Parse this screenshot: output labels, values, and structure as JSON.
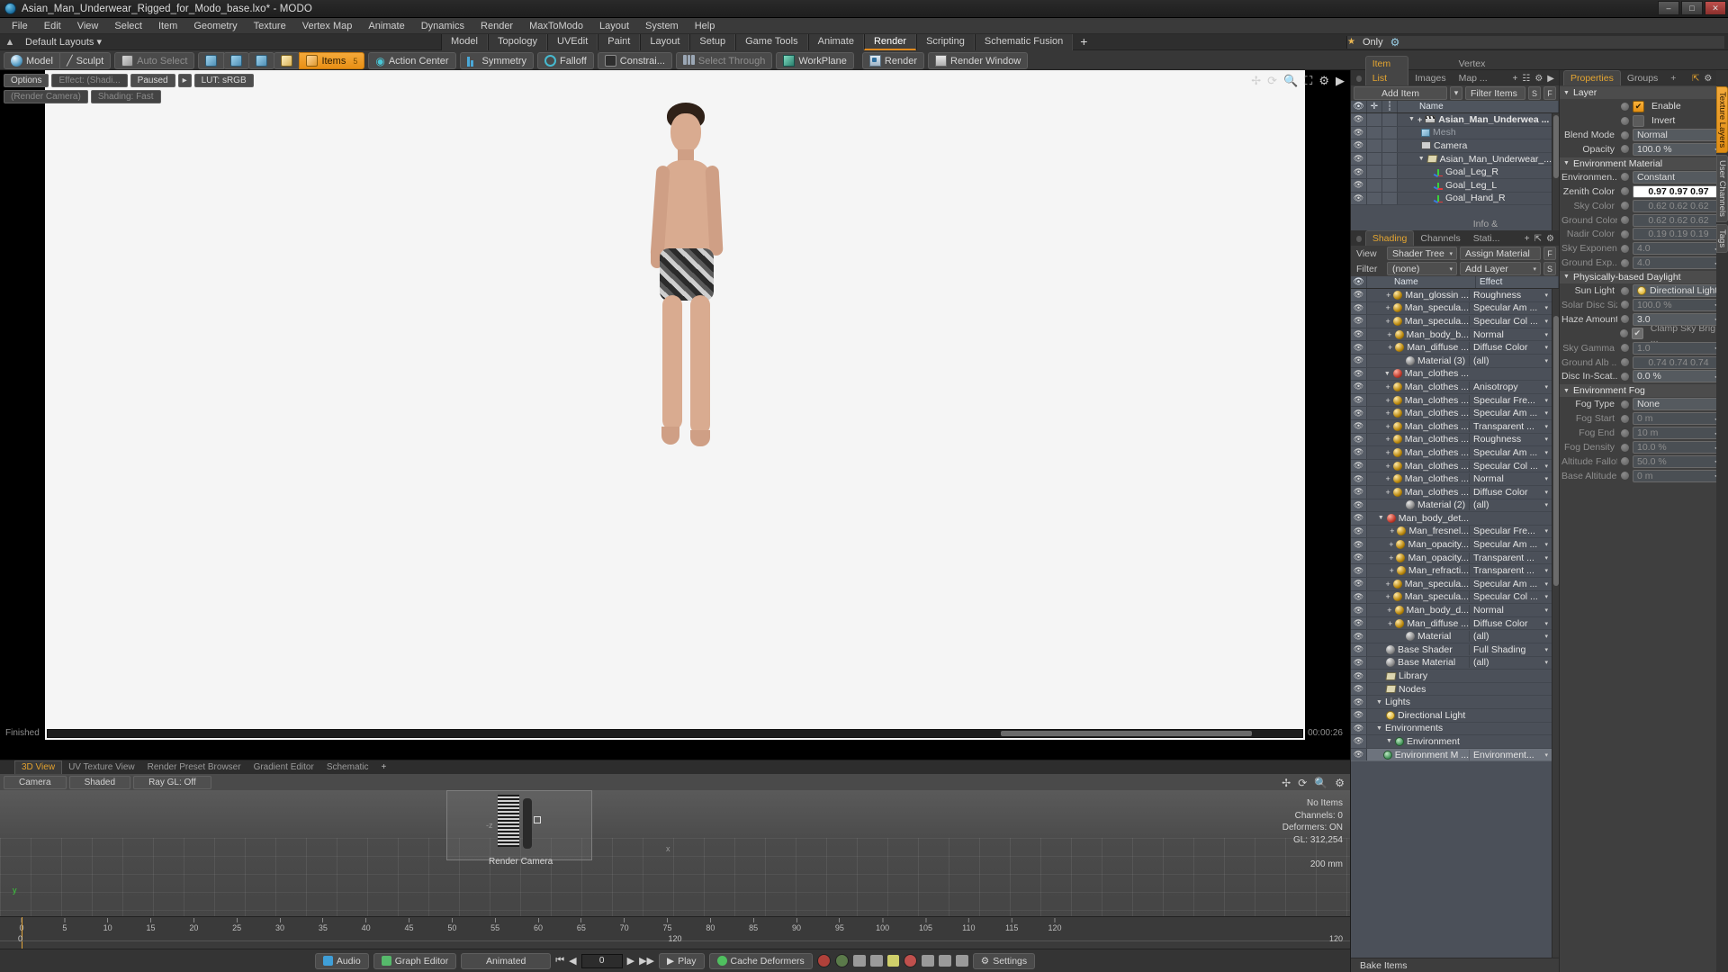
{
  "window": {
    "title": "Asian_Man_Underwear_Rigged_for_Modo_base.lxo* - MODO",
    "app_icon": "modo-app-icon",
    "minimize": "–",
    "maximize": "□",
    "close": "✕"
  },
  "menu": [
    "File",
    "Edit",
    "View",
    "Select",
    "Item",
    "Geometry",
    "Texture",
    "Vertex Map",
    "Animate",
    "Dynamics",
    "Render",
    "MaxToModo",
    "Layout",
    "System",
    "Help"
  ],
  "layout_row": {
    "home_icon": "home-icon",
    "preset_label": "Default Layouts",
    "tabs": [
      {
        "label": "Model",
        "active": false
      },
      {
        "label": "Topology",
        "active": false
      },
      {
        "label": "UVEdit",
        "active": false
      },
      {
        "label": "Paint",
        "active": false
      },
      {
        "label": "Layout",
        "active": false
      },
      {
        "label": "Setup",
        "active": false
      },
      {
        "label": "Game Tools",
        "active": false
      },
      {
        "label": "Animate",
        "active": false
      },
      {
        "label": "Render",
        "active": true
      },
      {
        "label": "Scripting",
        "active": false
      },
      {
        "label": "Schematic Fusion",
        "active": false
      }
    ],
    "add_tab": "+",
    "only_label": "Only",
    "star_icon": "star-icon",
    "gear_icon": "gear-icon"
  },
  "toolbar": {
    "mode_group": [
      {
        "label": "Model",
        "icon": "sphere-icon",
        "active": false
      },
      {
        "label": "Sculpt",
        "icon": "brush-icon",
        "active": false
      }
    ],
    "select_group": [
      {
        "label": "Auto Select",
        "icon": "cube-gray-icon",
        "dim": true
      }
    ],
    "component_group": [
      {
        "label": "",
        "icon": "vertex-cube-icon",
        "active": false
      },
      {
        "label": "",
        "icon": "edge-cube-icon",
        "active": false
      },
      {
        "label": "",
        "icon": "polygon-cube-icon",
        "active": false
      },
      {
        "label": "",
        "icon": "material-cube-icon",
        "active": false
      },
      {
        "label": "Items",
        "icon": "items-cube-icon",
        "active": true,
        "key": "5"
      }
    ],
    "tools_group": [
      {
        "label": "Action Center",
        "icon": "action-center-icon"
      },
      {
        "label": "Symmetry",
        "icon": "symmetry-icon"
      },
      {
        "label": "Falloff",
        "icon": "falloff-icon"
      },
      {
        "label": "Constrai...",
        "icon": "constraint-icon"
      },
      {
        "label": "Select Through",
        "icon": "select-through-icon",
        "dim": true
      },
      {
        "label": "WorkPlane",
        "icon": "workplane-icon"
      }
    ],
    "render_group": [
      {
        "label": "Render",
        "icon": "render-icon"
      },
      {
        "label": "Render Window",
        "icon": "render-window-icon"
      }
    ]
  },
  "viewport": {
    "chips": [
      {
        "label": "Options",
        "dim": false
      },
      {
        "label": "Effect: (Shadi...",
        "dim": true
      },
      {
        "label": "Paused",
        "dim": false
      },
      {
        "label": "▸",
        "dim": false
      },
      {
        "label": "LUT: sRGB",
        "dim": false
      }
    ],
    "camera_chip": "(Render Camera)",
    "shading_chip": "Shading: Fast",
    "icons": [
      "pan-icon",
      "rotate-icon",
      "zoom-icon",
      "fit-icon",
      "gear-icon",
      "chevron-right-icon"
    ],
    "status": "Finished",
    "time": "00:00:26"
  },
  "bottom_panel": {
    "tabs": [
      {
        "label": "3D View",
        "active": true
      },
      {
        "label": "UV Texture View",
        "active": false
      },
      {
        "label": "Render Preset Browser",
        "active": false
      },
      {
        "label": "Gradient Editor",
        "active": false
      },
      {
        "label": "Schematic",
        "active": false
      },
      {
        "label": "+",
        "active": false
      }
    ],
    "chips": [
      "Camera",
      "Shaded",
      "Ray GL: Off"
    ],
    "icons": [
      "move-icon",
      "rotate-icon",
      "zoom-icon",
      "gear-icon"
    ],
    "camera_label": "Render Camera",
    "axis_x": "x",
    "axis_z": "-z",
    "axis_gizmo": "y",
    "stats": [
      "No Items",
      "Channels: 0",
      "Deformers: ON",
      "GL: 312,254",
      "200 mm"
    ]
  },
  "timeline": {
    "ticks": [
      0,
      5,
      10,
      15,
      20,
      25,
      30,
      35,
      40,
      45,
      50,
      55,
      60,
      65,
      70,
      75,
      80,
      85,
      90,
      95,
      100,
      105,
      110,
      115,
      120
    ],
    "range_start": "0",
    "range_center": "120",
    "range_end": "120",
    "current_frame": "0"
  },
  "transport": {
    "audio": "Audio",
    "graph_editor": "Graph Editor",
    "animated": "Animated",
    "frame_value": "0",
    "play": "Play",
    "cache_deformers": "Cache Deformers",
    "settings": "Settings",
    "icons": [
      "audio-icon",
      "graph-editor-icon",
      "first-frame-icon",
      "prev-key-icon",
      "stop-icon",
      "play-icon",
      "next-key-icon",
      "last-frame-icon",
      "cache-icon",
      "record-icon",
      "link-icon",
      "key-icon",
      "auto-key-icon",
      "gear-icon"
    ]
  },
  "item_list": {
    "tabs": [
      {
        "label": "Item List",
        "active": true
      },
      {
        "label": "Images",
        "active": false
      },
      {
        "label": "Vertex Map ...",
        "active": false
      }
    ],
    "tab_tools": [
      "+",
      "grid-icon",
      "gear-icon",
      "chevron-icon"
    ],
    "add_item": "Add Item",
    "filter_items": "Filter Items",
    "filter_btn_s": "S",
    "filter_btn_f": "F",
    "columns": [
      "eye-icon",
      "lock-icon",
      "axis-icon",
      "Name"
    ],
    "rows": [
      {
        "name": "Asian_Man_Underwea ...",
        "icon": "clapper-icon",
        "indent": 0,
        "bold": true,
        "dim": false,
        "expander": "▼",
        "plus": "+"
      },
      {
        "name": "Mesh",
        "icon": "mesh-cube-icon",
        "indent": 1,
        "bold": false,
        "dim": true,
        "expander": "",
        "plus": ""
      },
      {
        "name": "Camera",
        "icon": "camera-icon",
        "indent": 1,
        "bold": false,
        "dim": false,
        "expander": "",
        "plus": ""
      },
      {
        "name": "Asian_Man_Underwear_...",
        "icon": "folder-icon",
        "indent": 1,
        "bold": false,
        "dim": false,
        "expander": "▼",
        "plus": ""
      },
      {
        "name": "Goal_Leg_R",
        "icon": "axis-icon",
        "indent": 2,
        "bold": false,
        "dim": false,
        "expander": "",
        "plus": ""
      },
      {
        "name": "Goal_Leg_L",
        "icon": "axis-icon",
        "indent": 2,
        "bold": false,
        "dim": false,
        "expander": "",
        "plus": ""
      },
      {
        "name": "Goal_Hand_R",
        "icon": "axis-icon",
        "indent": 2,
        "bold": false,
        "dim": false,
        "expander": "",
        "plus": ""
      }
    ]
  },
  "shader_tree": {
    "tabs": [
      {
        "label": "Shading",
        "active": true
      },
      {
        "label": "Channels",
        "active": false
      },
      {
        "label": "Info & Stati...",
        "active": false
      }
    ],
    "tab_tools": [
      "+",
      "expand-icon",
      "gear-icon"
    ],
    "view_label": "View",
    "view_value": "Shader Tree",
    "assign_material": "Assign Material",
    "filter_label": "Filter",
    "filter_value": "(none)",
    "add_layer": "Add Layer",
    "btn_f": "F",
    "btn_s": "S",
    "columns": [
      "eye-icon",
      "Name",
      "Effect"
    ],
    "rows": [
      {
        "name": "Man_glossin ...",
        "effect": "Roughness",
        "icon": "material-sphere",
        "indent": 3,
        "plus": "+",
        "expander": ""
      },
      {
        "name": "Man_specula...",
        "effect": "Specular Am ...",
        "icon": "material-sphere",
        "indent": 3,
        "plus": "+",
        "expander": ""
      },
      {
        "name": "Man_specula...",
        "effect": "Specular Col ...",
        "icon": "material-sphere",
        "indent": 3,
        "plus": "+",
        "expander": ""
      },
      {
        "name": "Man_body_b...",
        "effect": "Normal",
        "icon": "material-sphere",
        "indent": 3,
        "plus": "+",
        "expander": ""
      },
      {
        "name": "Man_diffuse ...",
        "effect": "Diffuse Color",
        "icon": "material-sphere",
        "indent": 3,
        "plus": "+",
        "expander": ""
      },
      {
        "name": "Material (3)",
        "effect": "(all)",
        "icon": "material-sphere-gray",
        "indent": 3,
        "plus": "",
        "expander": ""
      },
      {
        "name": "Man_clothes ...",
        "effect": "",
        "icon": "material-sphere-red",
        "indent": 2,
        "plus": "",
        "expander": "▼"
      },
      {
        "name": "Man_clothes ...",
        "effect": "Anisotropy",
        "icon": "material-sphere",
        "indent": 3,
        "plus": "+",
        "expander": ""
      },
      {
        "name": "Man_clothes ...",
        "effect": "Specular Fre...",
        "icon": "material-sphere",
        "indent": 3,
        "plus": "+",
        "expander": ""
      },
      {
        "name": "Man_clothes ...",
        "effect": "Specular Am ...",
        "icon": "material-sphere",
        "indent": 3,
        "plus": "+",
        "expander": ""
      },
      {
        "name": "Man_clothes ...",
        "effect": "Transparent ...",
        "icon": "material-sphere",
        "indent": 3,
        "plus": "+",
        "expander": ""
      },
      {
        "name": "Man_clothes ...",
        "effect": "Roughness",
        "icon": "material-sphere",
        "indent": 3,
        "plus": "+",
        "expander": ""
      },
      {
        "name": "Man_clothes ...",
        "effect": "Specular Am ...",
        "icon": "material-sphere",
        "indent": 3,
        "plus": "+",
        "expander": ""
      },
      {
        "name": "Man_clothes ...",
        "effect": "Specular Col ...",
        "icon": "material-sphere",
        "indent": 3,
        "plus": "+",
        "expander": ""
      },
      {
        "name": "Man_clothes ...",
        "effect": "Normal",
        "icon": "material-sphere",
        "indent": 3,
        "plus": "+",
        "expander": ""
      },
      {
        "name": "Man_clothes ...",
        "effect": "Diffuse Color",
        "icon": "material-sphere",
        "indent": 3,
        "plus": "+",
        "expander": ""
      },
      {
        "name": "Material (2)",
        "effect": "(all)",
        "icon": "material-sphere-gray",
        "indent": 3,
        "plus": "",
        "expander": ""
      },
      {
        "name": "Man_body_det...",
        "effect": "",
        "icon": "material-sphere-red",
        "indent": 2,
        "plus": "",
        "expander": "▼"
      },
      {
        "name": "Man_fresnel...",
        "effect": "Specular Fre...",
        "icon": "material-sphere",
        "indent": 3,
        "plus": "+",
        "expander": ""
      },
      {
        "name": "Man_opacity...",
        "effect": "Specular Am ...",
        "icon": "material-sphere",
        "indent": 3,
        "plus": "+",
        "expander": ""
      },
      {
        "name": "Man_opacity...",
        "effect": "Transparent ...",
        "icon": "material-sphere",
        "indent": 3,
        "plus": "+",
        "expander": ""
      },
      {
        "name": "Man_refracti...",
        "effect": "Transparent ...",
        "icon": "material-sphere",
        "indent": 3,
        "plus": "+",
        "expander": ""
      },
      {
        "name": "Man_specula...",
        "effect": "Specular Am ...",
        "icon": "material-sphere",
        "indent": 3,
        "plus": "+",
        "expander": ""
      },
      {
        "name": "Man_specula...",
        "effect": "Specular Col ...",
        "icon": "material-sphere",
        "indent": 3,
        "plus": "+",
        "expander": ""
      },
      {
        "name": "Man_body_d...",
        "effect": "Normal",
        "icon": "material-sphere",
        "indent": 3,
        "plus": "+",
        "expander": ""
      },
      {
        "name": "Man_diffuse ...",
        "effect": "Diffuse Color",
        "icon": "material-sphere",
        "indent": 3,
        "plus": "+",
        "expander": ""
      },
      {
        "name": "Material",
        "effect": "(all)",
        "icon": "material-sphere-gray",
        "indent": 3,
        "plus": "",
        "expander": ""
      },
      {
        "name": "Base Shader",
        "effect": "Full Shading",
        "icon": "shader-icon",
        "indent": 1,
        "plus": "",
        "expander": ""
      },
      {
        "name": "Base Material",
        "effect": "(all)",
        "icon": "material-sphere-gray",
        "indent": 1,
        "plus": "",
        "expander": ""
      },
      {
        "name": "Library",
        "effect": "",
        "icon": "folder-icon",
        "indent": 1,
        "plus": "",
        "expander": ""
      },
      {
        "name": "Nodes",
        "effect": "",
        "icon": "folder-icon",
        "indent": 1,
        "plus": "",
        "expander": ""
      },
      {
        "name": "Lights",
        "effect": "",
        "icon": "",
        "indent": 0,
        "plus": "",
        "expander": "▼"
      },
      {
        "name": "Directional Light",
        "effect": "",
        "icon": "light-icon",
        "indent": 1,
        "plus": "",
        "expander": ""
      },
      {
        "name": "Environments",
        "effect": "",
        "icon": "",
        "indent": 0,
        "plus": "",
        "expander": "▼"
      },
      {
        "name": "Environment",
        "effect": "",
        "icon": "env-icon",
        "indent": 1,
        "plus": "",
        "expander": "▼"
      },
      {
        "name": "Environment M ...",
        "effect": "Environment...",
        "icon": "env-icon",
        "indent": 2,
        "plus": "",
        "expander": "",
        "selected": true
      }
    ],
    "bake_items": "Bake Items"
  },
  "properties": {
    "tabs": [
      {
        "label": "Properties",
        "active": true
      },
      {
        "label": "Groups",
        "active": false
      },
      {
        "label": "+",
        "active": false
      }
    ],
    "tab_tools": [
      "expand-icon",
      "gear-icon",
      "chevron-icon"
    ],
    "vertical_tabs": [
      {
        "label": "Texture Layers",
        "active": true
      },
      {
        "label": "User Channels",
        "active": false
      },
      {
        "label": "Tags",
        "active": false
      }
    ],
    "sections": [
      {
        "title": "Layer",
        "rows": [
          {
            "type": "check",
            "label": "Enable",
            "checked": true,
            "dim": false
          },
          {
            "type": "check",
            "label": "Invert",
            "checked": false,
            "dim": false
          },
          {
            "type": "dropdown",
            "label": "Blend Mode",
            "value": "Normal",
            "dim": false
          },
          {
            "type": "spin",
            "label": "Opacity",
            "value": "100.0 %",
            "dim": false
          }
        ]
      },
      {
        "title": "Environment Material",
        "rows": [
          {
            "type": "dropdown",
            "label": "Environmen...",
            "value": "Constant",
            "dim": false
          },
          {
            "type": "white",
            "label": "Zenith Color",
            "value": "0.97 0.97 0.97",
            "dim": false
          },
          {
            "type": "text",
            "label": "Sky Color",
            "value": "0.62 0.62 0.62",
            "dim": true
          },
          {
            "type": "text",
            "label": "Ground Color",
            "value": "0.62 0.62 0.62",
            "dim": true
          },
          {
            "type": "text",
            "label": "Nadir Color",
            "value": "0.19 0.19 0.19",
            "dim": true
          },
          {
            "type": "spin",
            "label": "Sky Exponent",
            "value": "4.0",
            "dim": true
          },
          {
            "type": "spin",
            "label": "Ground Exp...",
            "value": "4.0",
            "dim": true
          }
        ]
      },
      {
        "title": "Physically-based Daylight",
        "rows": [
          {
            "type": "dropdown-icon",
            "label": "Sun Light",
            "value": "Directional Light",
            "dim": false
          },
          {
            "type": "spin",
            "label": "Solar Disc Size",
            "value": "100.0 %",
            "dim": true
          },
          {
            "type": "spin",
            "label": "Haze Amount",
            "value": "3.0",
            "dim": false
          },
          {
            "type": "check",
            "label": "Clamp Sky Brig ...",
            "checked": true,
            "dim": true
          },
          {
            "type": "spin",
            "label": "Sky Gamma",
            "value": "1.0",
            "dim": true
          },
          {
            "type": "text",
            "label": "Ground Alb ...",
            "value": "0.74 0.74 0.74",
            "dim": true
          },
          {
            "type": "spin",
            "label": "Disc In-Scat...",
            "value": "0.0 %",
            "dim": false
          }
        ]
      },
      {
        "title": "Environment Fog",
        "rows": [
          {
            "type": "dropdown",
            "label": "Fog Type",
            "value": "None",
            "dim": false
          },
          {
            "type": "spin",
            "label": "Fog Start",
            "value": "0 m",
            "dim": true
          },
          {
            "type": "spin",
            "label": "Fog End",
            "value": "10 m",
            "dim": true
          },
          {
            "type": "spin",
            "label": "Fog Density",
            "value": "10.0 %",
            "dim": true
          },
          {
            "type": "spin",
            "label": "Altitude Falloff",
            "value": "50.0 %",
            "dim": true
          },
          {
            "type": "spin",
            "label": "Base Altitude",
            "value": "0 m",
            "dim": true
          }
        ]
      }
    ]
  },
  "colors": {
    "accent": "#e2a12e",
    "panel_bg": "#3d3d3d",
    "list_bg": "#4b5059",
    "header_bg": "#4f555e",
    "title_bg": "#1e1e1e"
  }
}
